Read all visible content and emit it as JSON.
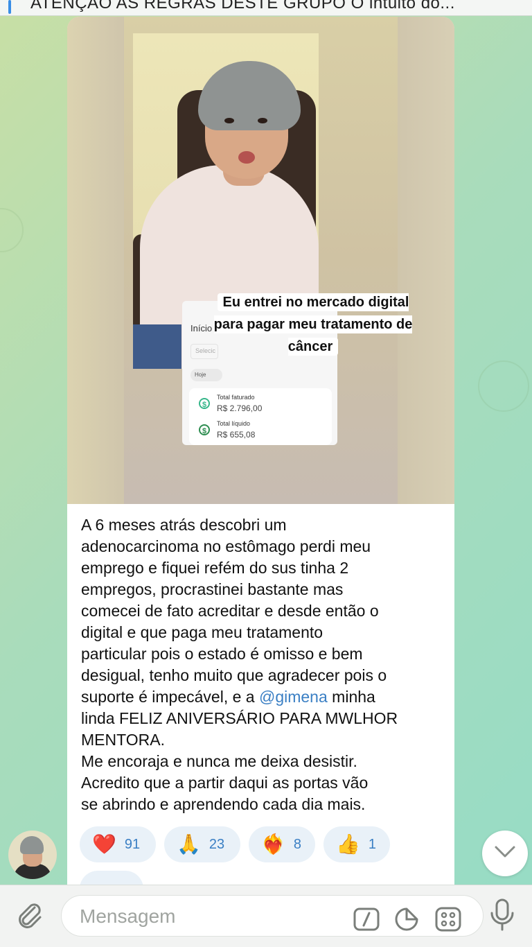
{
  "pinned": {
    "text": "ATENÇÃO AS REGRAS DESTE GRUPO O intuito do..."
  },
  "post": {
    "overlay_caption": "Eu entrei no mercado digital para pagar meu tratamento de câncer",
    "dashboard": {
      "nav_label": "Início",
      "select_placeholder": "Selecic",
      "date_filter": "Hoje",
      "total_billed_label": "Total faturado",
      "total_billed_value": "R$ 2.796,00",
      "total_net_label": "Total líquido",
      "total_net_value": "R$ 655,08"
    },
    "message_before_mention": "A 6 meses atrás descobri um\nadenocarcinoma no estômago perdi meu\nemprego e fiquei refém do sus tinha 2\nempregos, procrastinei bastante mas\ncomecei de fato acreditar e desde então o\ndigital e que paga meu tratamento\nparticular pois o estado é omisso e bem\ndesigual, tenho muito que agradecer pois o\nsuporte é impecável, e a ",
    "mention": "@gimena",
    "message_after_mention": " minha\nlinda FELIZ ANIVERSÁRIO PARA MWLHOR\nMENTORA.\nMe encoraja e nunca me deixa desistir.\nAcredito que a partir daqui as portas vão\nse abrindo e aprendendo cada dia mais.",
    "reactions": [
      {
        "emoji": "❤️",
        "icon": "heart-icon",
        "count": "91"
      },
      {
        "emoji": "🙏",
        "icon": "praying-hands-icon",
        "count": "23"
      },
      {
        "emoji": "❤️‍🔥",
        "icon": "heart-on-fire-icon",
        "count": "8"
      },
      {
        "emoji": "👍",
        "icon": "thumbs-up-icon",
        "count": "1"
      }
    ]
  },
  "composer": {
    "placeholder": "Mensagem"
  },
  "colors": {
    "accent": "#3a7fc4",
    "reaction_bg": "#e9f1f8",
    "wallpaper": "#a9dcbb"
  }
}
